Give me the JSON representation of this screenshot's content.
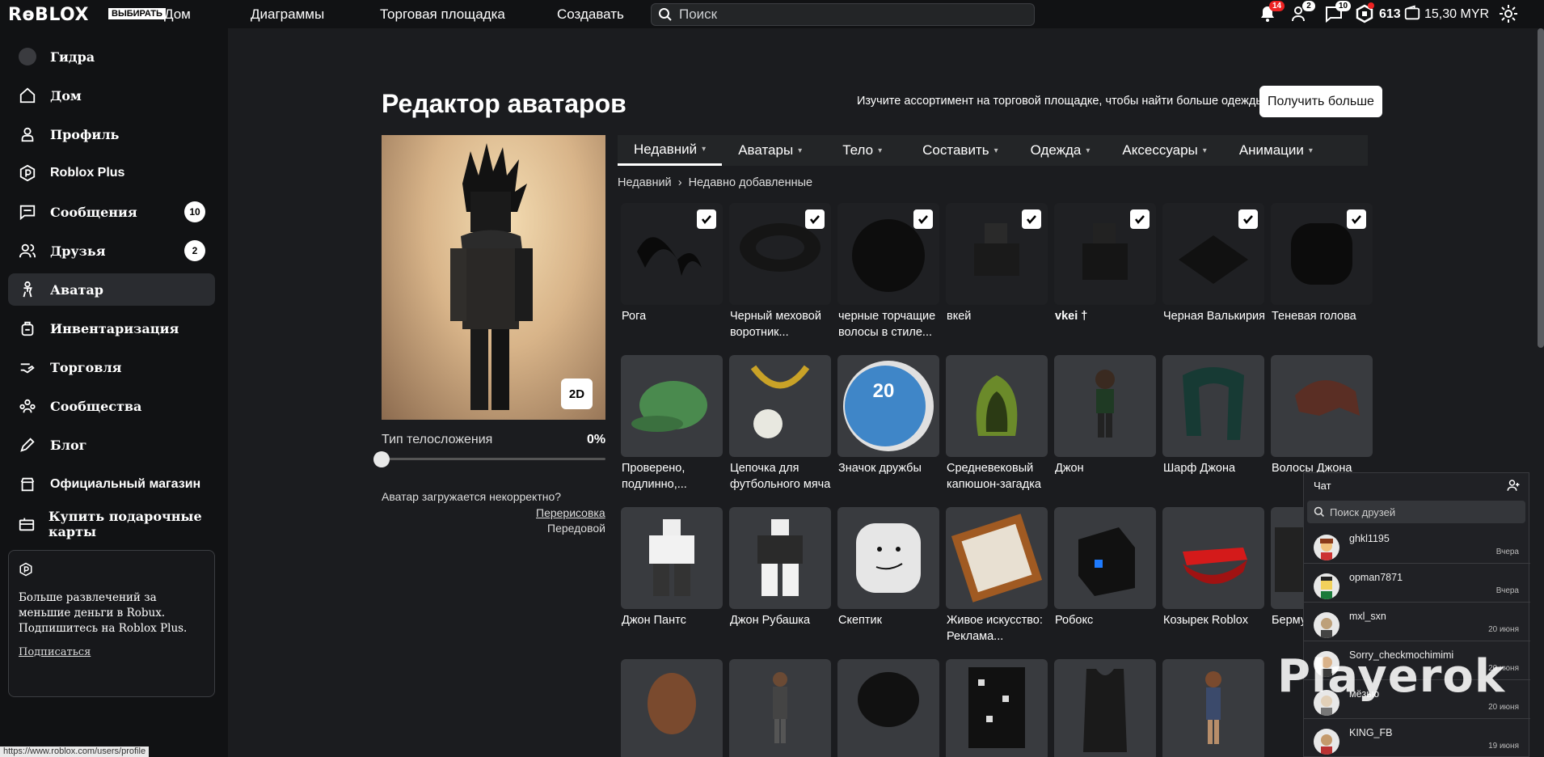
{
  "topbar": {
    "logo": "RɵBLOX",
    "logo_badge": "ВЫБИРАТЬ",
    "nav": [
      "Дом",
      "Диаграммы",
      "Торговая площадка",
      "Создавать"
    ],
    "search_placeholder": "Поиск",
    "notifications": "14",
    "friends": "2",
    "messages": "10",
    "robux": "613",
    "wallet": "15,30 MYR"
  },
  "sidebar": {
    "username": "Гидра",
    "items": [
      {
        "label": "Дом"
      },
      {
        "label": "Профиль"
      },
      {
        "label": "Roblox Plus"
      },
      {
        "label": "Сообщения",
        "count": "10"
      },
      {
        "label": "Друзья",
        "count": "2"
      },
      {
        "label": "Аватар"
      },
      {
        "label": "Инвентаризация"
      },
      {
        "label": "Торговля"
      },
      {
        "label": "Сообщества"
      },
      {
        "label": "Блог"
      },
      {
        "label": "Официальный магазин"
      },
      {
        "label": "Купить подарочные карты"
      }
    ],
    "promo_text": "Больше развлечений за меньшие деньги в Robux. Подпишитесь на Roblox Plus.",
    "promo_link": "Подписаться"
  },
  "editor": {
    "title": "Редактор аватаров",
    "promo_line": "Изучите ассортимент на торговой площадке, чтобы найти больше одежды!",
    "get_more": "Получить больше",
    "view_toggle": "2D",
    "body_type_label": "Тип телосложения",
    "body_type_value": "0%",
    "bad_load": "Аватар загружается некорректно?",
    "redraw": "Перерисовка",
    "front": "Передовой",
    "tabs": [
      "Недавний",
      "Аватары",
      "Тело",
      "Составить",
      "Одежда",
      "Аксессуары",
      "Анимации"
    ],
    "breadcrumb": [
      "Недавний",
      "Недавно добавленные"
    ]
  },
  "items_row1": [
    {
      "name": "Рога"
    },
    {
      "name": "Черный меховой воротник..."
    },
    {
      "name": "черные торчащие волосы в стиле..."
    },
    {
      "name": "вкей"
    },
    {
      "name": "vkei †"
    },
    {
      "name": "Черная Валькирия"
    },
    {
      "name": "Теневая голова"
    }
  ],
  "items_row2": [
    {
      "name": "Проверено, подлинно,..."
    },
    {
      "name": "Цепочка для футбольного мяча"
    },
    {
      "name": "Значок дружбы"
    },
    {
      "name": "Средневековый капюшон-загадка"
    },
    {
      "name": "Джон"
    },
    {
      "name": "Шарф Джона"
    },
    {
      "name": "Волосы Джона"
    }
  ],
  "items_row3": [
    {
      "name": "Джон Пантс"
    },
    {
      "name": "Джон Рубашка"
    },
    {
      "name": "Скептик"
    },
    {
      "name": "Живое искусство: Реклама..."
    },
    {
      "name": "Робокс"
    },
    {
      "name": "Козырек Roblox"
    },
    {
      "name": "Берму..."
    }
  ],
  "badge_number": "20",
  "chat": {
    "title": "Чат",
    "search_placeholder": "Поиск друзей",
    "rows": [
      {
        "name": "ghkl1195",
        "time": "Вчера"
      },
      {
        "name": "opman7871",
        "time": "Вчера"
      },
      {
        "name": "mxl_sxn",
        "time": "20 июня"
      },
      {
        "name": "Sorry_checkmochimimi",
        "time": "20 июня"
      },
      {
        "name": "мёзью",
        "time": "20 июня"
      },
      {
        "name": "KING_FB",
        "time": "19 июня"
      }
    ]
  },
  "watermark": "Playerok",
  "status_url": "https://www.roblox.com/users/profile"
}
